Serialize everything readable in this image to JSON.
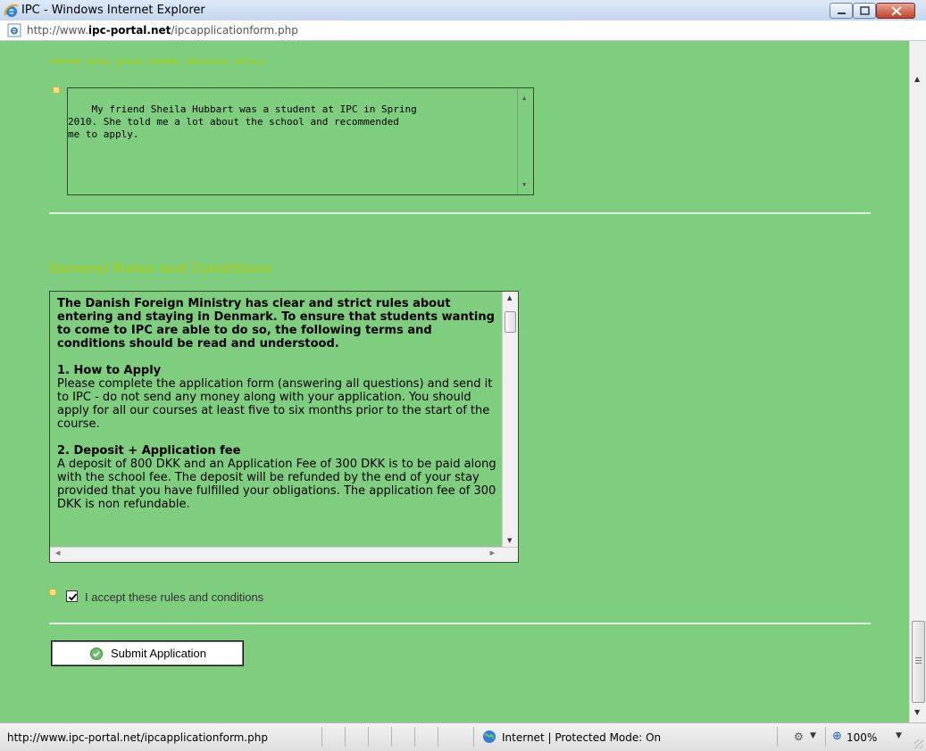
{
  "window": {
    "title": "IPC - Windows Internet Explorer",
    "url_prefix": "http://www.",
    "url_domain": "ipc-portal.net",
    "url_path": "/ipcapplicationform.php"
  },
  "form": {
    "hear_heading": "How did you hear about IPC?",
    "hear_answer": "My friend Sheila Hubbart was a student at IPC in Spring\n2010. She told me a lot about the school and recommended\nme to apply.",
    "rules_title": "General Rules and Conditions",
    "rules": {
      "intro": "The Danish Foreign Ministry has clear and strict rules about entering and staying in Denmark. To ensure that students wanting to come to IPC are able to do so, the following terms and conditions should be read and understood.",
      "s1_heading": "1. How to Apply",
      "s1_text": "Please complete the application form (answering all questions) and send it to IPC - do not send any money along with your application. You should apply for all our courses at least five to six months prior to the start of the course.",
      "s2_heading": "2. Deposit + Application fee",
      "s2_text": "A deposit of 800 DKK and an Application Fee of 300 DKK is to be paid along with the school fee. The deposit will be refunded by the end of your stay provided that you have fulfilled your obligations. The application fee of 300 DKK is non refundable."
    },
    "accept_label": "I accept these rules and conditions",
    "accept_checked": true,
    "submit_label": "Submit Application"
  },
  "status": {
    "url": "http://www.ipc-portal.net/ipcapplicationform.php",
    "zone": "Internet | Protected Mode: On",
    "zoom": "100%"
  },
  "colors": {
    "page_bg": "#7fcd7f",
    "heading": "#9acd32",
    "divider": "#e3f3e3"
  }
}
